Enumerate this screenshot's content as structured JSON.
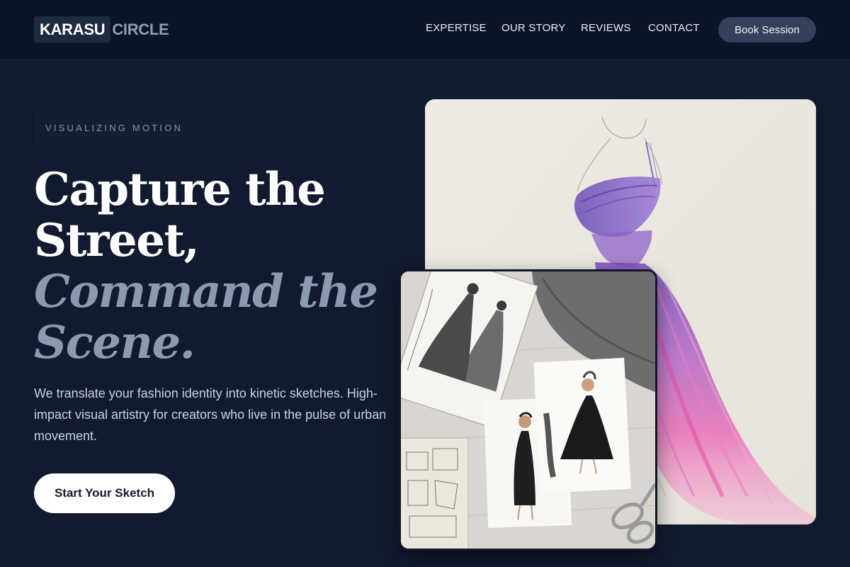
{
  "brand": {
    "primary": "KARASU",
    "secondary": "CIRCLE"
  },
  "nav": {
    "items": [
      {
        "label": "EXPERTISE"
      },
      {
        "label": "OUR STORY"
      },
      {
        "label": "REVIEWS"
      },
      {
        "label": "CONTACT"
      }
    ],
    "cta_label": "Book Session"
  },
  "hero": {
    "eyebrow": "VISUALIZING MOTION",
    "headline": {
      "line1": "Capture the",
      "line2": "Street,",
      "line3": "Command the",
      "line4": "Scene."
    },
    "lead": "We translate your fashion identity into kinetic sketches. High-impact visual artistry for creators who live in the pulse of urban movement.",
    "cta_label": "Start Your Sketch"
  },
  "colors": {
    "background": "#111a2e",
    "header": "#0b1326",
    "accent_text": "#8c9ab1",
    "button_dark": "#33425a",
    "button_light": "#ffffff"
  }
}
